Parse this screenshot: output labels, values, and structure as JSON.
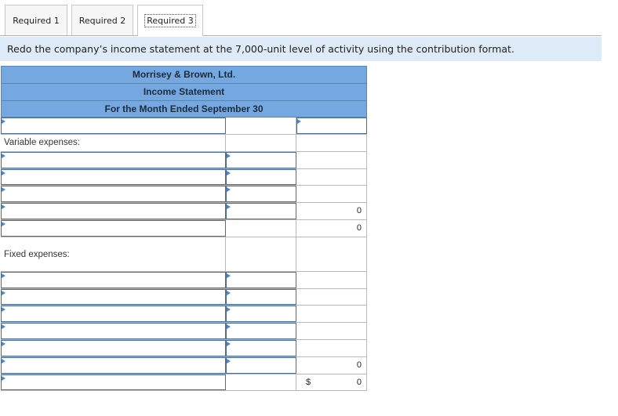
{
  "tabs": [
    {
      "label": "Required 1"
    },
    {
      "label": "Required 2"
    },
    {
      "label": "Required 3"
    }
  ],
  "instruction": "Redo the company’s income statement at the 7,000-unit level of activity using the contribution format.",
  "statement": {
    "company": "Morrisey & Brown, Ltd.",
    "title": "Income Statement",
    "period": "For the Month Ended September 30",
    "variable_label": "Variable expenses:",
    "fixed_label": "Fixed expenses:",
    "total_variable": "0",
    "contribution_margin": "0",
    "total_fixed": "0",
    "net_operating_income": "0",
    "currency_symbol": "$"
  }
}
